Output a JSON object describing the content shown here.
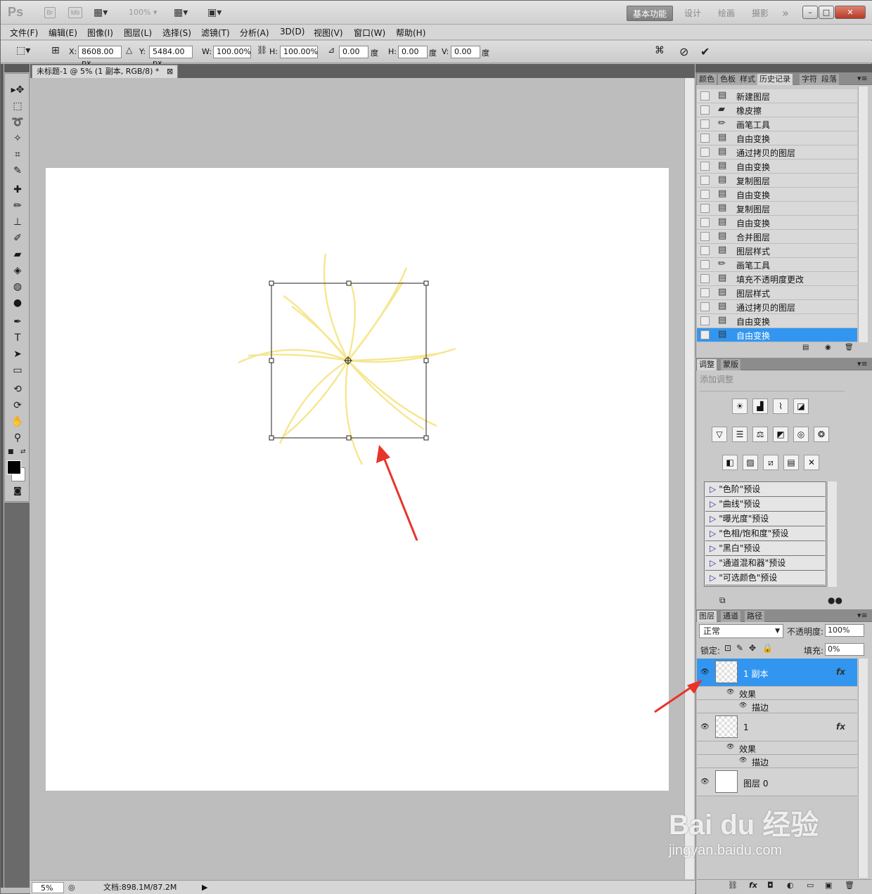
{
  "titlebar": {
    "logo": "Ps",
    "chip_br": "Br",
    "chip_mb": "Mb",
    "zoom": "100%",
    "workspaces": [
      "基本功能",
      "设计",
      "绘画",
      "摄影"
    ],
    "more": "»",
    "win_min": "–",
    "win_max": "□",
    "win_close": "✕"
  },
  "menu": [
    "文件(F)",
    "编辑(E)",
    "图像(I)",
    "图层(L)",
    "选择(S)",
    "滤镜(T)",
    "分析(A)",
    "3D(D)",
    "视图(V)",
    "窗口(W)",
    "帮助(H)"
  ],
  "options": {
    "x_label": "X:",
    "x_value": "8608.00 px",
    "y_label": "Y:",
    "y_value": "5484.00 px",
    "w_label": "W:",
    "w_value": "100.00%",
    "h_label": "H:",
    "h_value": "100.00%",
    "angle_value": "0.00",
    "angle_unit": "度",
    "hskew_label": "H:",
    "hskew_value": "0.00",
    "hskew_unit": "度",
    "vskew_label": "V:",
    "vskew_value": "0.00",
    "vskew_unit": "度"
  },
  "document": {
    "tab_title": "未标题-1 @ 5% (1 副本, RGB/8) *",
    "zoom": "5%",
    "doc_size": "文档:898.1M/87.2M"
  },
  "panel_history": {
    "tabs": [
      "颜色",
      "色板",
      "样式",
      "历史记录",
      "字符",
      "段落"
    ],
    "active_tab": "历史记录",
    "items": [
      "新建图层",
      "橡皮擦",
      "画笔工具",
      "自由变换",
      "通过拷贝的图层",
      "自由变换",
      "复制图层",
      "自由变换",
      "复制图层",
      "自由变换",
      "合并图层",
      "图层样式",
      "画笔工具",
      "填充不透明度更改",
      "图层样式",
      "通过拷贝的图层",
      "自由变换",
      "自由变换"
    ]
  },
  "panel_adjust": {
    "tabs": [
      "调整",
      "蒙版"
    ],
    "heading": "添加调整",
    "presets": [
      "\"色阶\"预设",
      "\"曲线\"预设",
      "\"曝光度\"预设",
      "\"色相/饱和度\"预设",
      "\"黑白\"预设",
      "\"通道混和器\"预设",
      "\"可选颜色\"预设"
    ]
  },
  "panel_layers": {
    "tabs": [
      "图层",
      "通道",
      "路径"
    ],
    "blend_mode": "正常",
    "opacity_label": "不透明度:",
    "opacity": "100%",
    "lock_label": "锁定:",
    "fill_label": "填充:",
    "fill": "0%",
    "effects_label": "效果",
    "stroke_label": "描边",
    "layers": [
      {
        "name": "1 副本",
        "fx": "fx"
      },
      {
        "name": "1",
        "fx": "fx"
      },
      {
        "name": "图层 0",
        "fx": ""
      }
    ]
  },
  "watermark": {
    "line1": "Bai du 经验",
    "line2": "jingyan.baidu.com"
  },
  "colors": {
    "accent": "#3296f0",
    "arrow": "#e8332a",
    "brush": "#f6e58a"
  }
}
